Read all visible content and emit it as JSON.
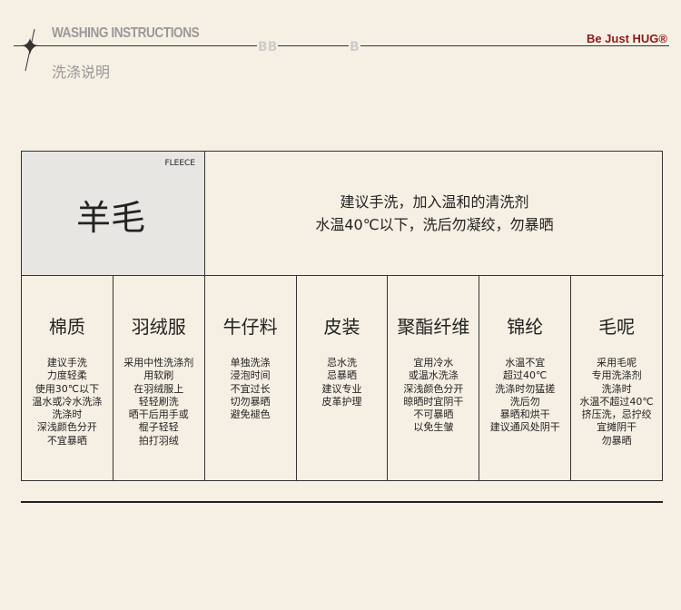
{
  "header": {
    "title_en": "WASHING INSTRUCTIONS",
    "title_cn": "洗涤说明",
    "brand": "Be Just HUG®",
    "deco1": "BB",
    "deco2": "B"
  },
  "fleece": {
    "tag": "FLEECE",
    "name": "羊毛",
    "desc": [
      "建议手洗，加入温和的清洗剂",
      "水温40℃以下，洗后勿凝绞，勿暴晒"
    ]
  },
  "materials": [
    {
      "name": "棉质",
      "lines": [
        "建议手洗",
        "力度轻柔",
        "使用30℃以下",
        "温水或冷水洗涤",
        "洗涤时",
        "深浅颜色分开",
        "不宜暴晒"
      ]
    },
    {
      "name": "羽绒服",
      "lines": [
        "采用中性洗涤剂",
        "用软刷",
        "在羽绒服上",
        "轻轻刷洗",
        "晒干后用手或",
        "棍子轻轻",
        "拍打羽绒"
      ]
    },
    {
      "name": "牛仔料",
      "lines": [
        "单独洗涤",
        "浸泡时间",
        "不宜过长",
        "切勿暴晒",
        "避免褪色"
      ]
    },
    {
      "name": "皮装",
      "lines": [
        "忌水洗",
        "忌暴晒",
        "建议专业",
        "皮革护理"
      ]
    },
    {
      "name": "聚酯纤维",
      "lines": [
        "宜用冷水",
        "或温水洗涤",
        "深浅颜色分开",
        "晾晒时宜阴干",
        "不可暴晒",
        "以免生皱"
      ]
    },
    {
      "name": "锦纶",
      "lines": [
        "水温不宜",
        "超过40℃",
        "洗涤时勿猛搓",
        "洗后勿",
        "暴晒和烘干",
        "建议通风处阴干"
      ]
    },
    {
      "name": "毛呢",
      "lines": [
        "采用毛呢",
        "专用洗涤剂",
        "洗涤时",
        "水温不超过40℃",
        "挤压洗，忌拧绞",
        "宜摊阴干",
        "勿暴晒"
      ]
    }
  ]
}
